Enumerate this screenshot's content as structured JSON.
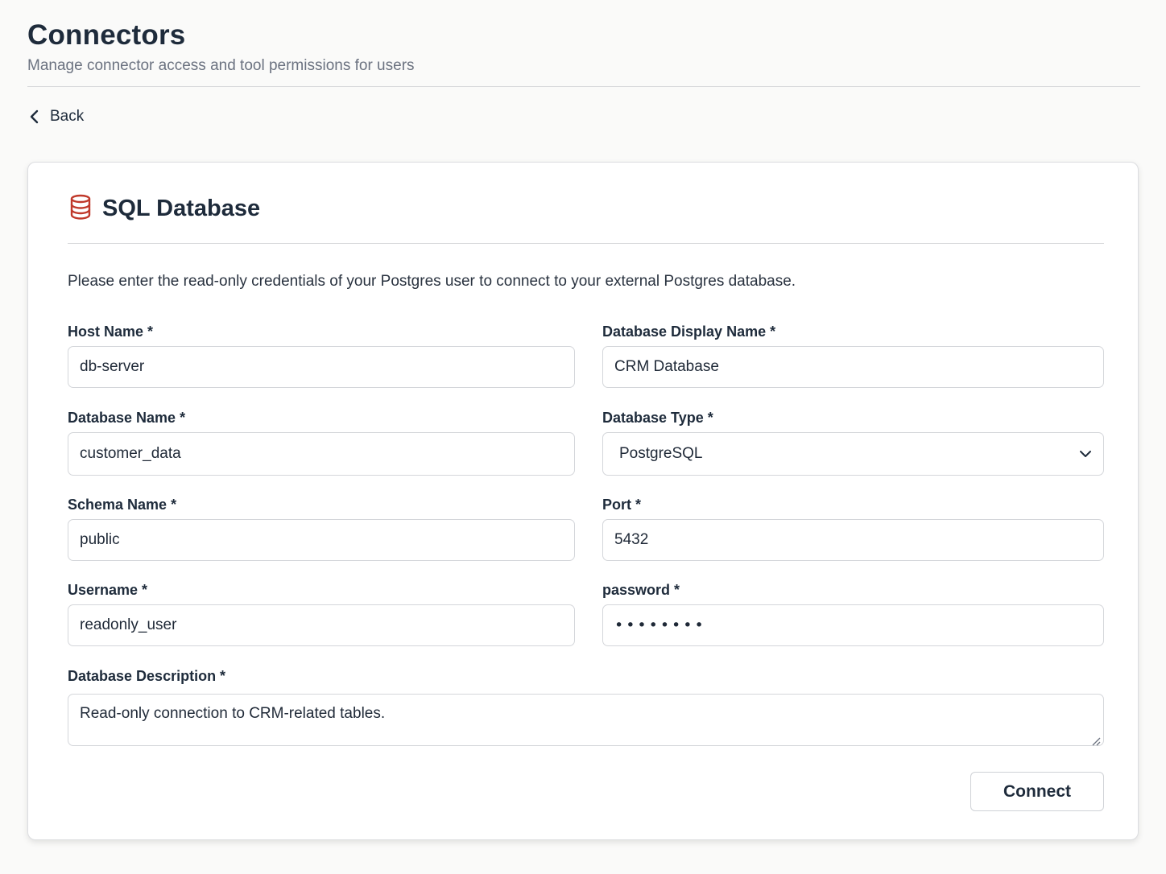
{
  "header": {
    "title": "Connectors",
    "subtitle": "Manage connector access and tool permissions for users"
  },
  "back": {
    "label": "Back",
    "icon": "chevron-left-icon"
  },
  "card": {
    "icon": "database-icon",
    "icon_color": "#c0392b",
    "title": "SQL Database",
    "intro": "Please enter the read-only credentials of your Postgres user to connect to your external Postgres database."
  },
  "form": {
    "host_name": {
      "label": "Host Name *",
      "value": "db-server"
    },
    "display_name": {
      "label": "Database Display Name *",
      "value": "CRM Database"
    },
    "database_name": {
      "label": "Database Name *",
      "value": "customer_data"
    },
    "database_type": {
      "label": "Database Type *",
      "value": "PostgreSQL",
      "icon": "chevron-down-icon"
    },
    "schema_name": {
      "label": "Schema Name *",
      "value": "public"
    },
    "port": {
      "label": "Port *",
      "value": "5432"
    },
    "username": {
      "label": "Username *",
      "value": "readonly_user"
    },
    "password": {
      "label": "password *",
      "masked_value": "••••••••"
    },
    "description": {
      "label": "Database Description *",
      "value": "Read-only connection to CRM-related tables."
    }
  },
  "actions": {
    "connect_label": "Connect"
  }
}
